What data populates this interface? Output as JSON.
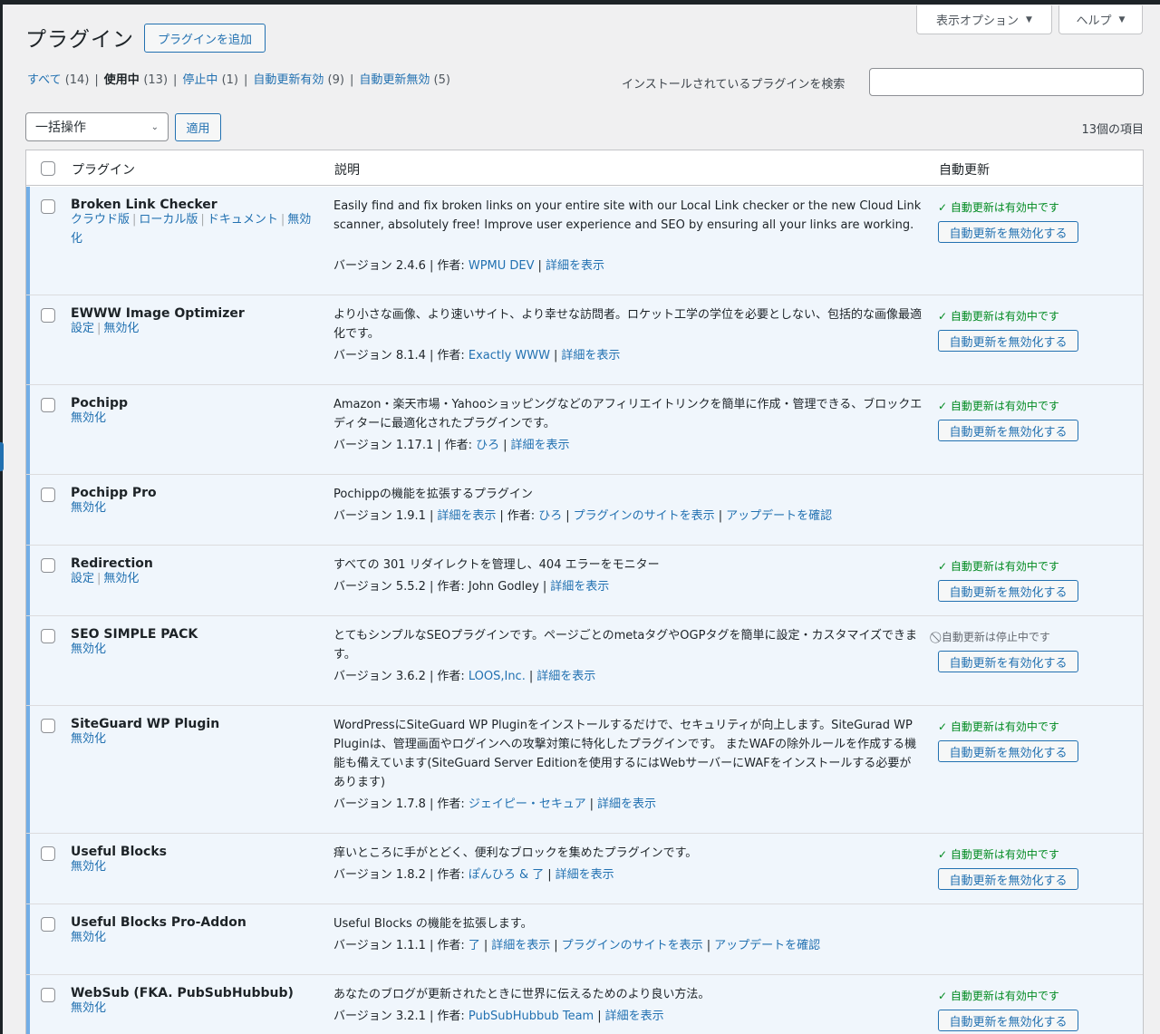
{
  "screen_options": {
    "label": "表示オプション"
  },
  "help": {
    "label": "ヘルプ"
  },
  "page": {
    "title": "プラグイン",
    "add_button": "プラグインを追加"
  },
  "filters": [
    {
      "label": "すべて",
      "count": "(14)"
    },
    {
      "label": "使用中",
      "count": "(13)"
    },
    {
      "label": "停止中",
      "count": "(1)"
    },
    {
      "label": "自動更新有効",
      "count": "(9)"
    },
    {
      "label": "自動更新無効",
      "count": "(5)"
    }
  ],
  "search": {
    "label": "インストールされているプラグインを検索",
    "value": ""
  },
  "bulk": {
    "selected": "一括操作",
    "apply": "適用",
    "item_count": "13個の項目"
  },
  "columns": {
    "plugin": "プラグイン",
    "description": "説明",
    "auto_update": "自動更新"
  },
  "plugins": [
    {
      "name": "Broken Link Checker",
      "actions": [
        "クラウド版",
        "ローカル版",
        "ドキュメント",
        "無効化"
      ],
      "description": "Easily find and fix broken links on your entire site with our Local Link checker or the new Cloud Link scanner, absolutely free! Improve user experience and SEO by ensuring all your links are working.",
      "meta": [
        {
          "text": "バージョン 2.4.6"
        },
        {
          "text": "作者: ",
          "link": "WPMU DEV"
        },
        {
          "link": "詳細を表示"
        }
      ],
      "au_status": "✓ 自動更新は有効中です",
      "au_button": "自動更新を無効化する"
    },
    {
      "name": "EWWW Image Optimizer",
      "actions": [
        "設定",
        "無効化"
      ],
      "description": "より小さな画像、より速いサイト、より幸せな訪問者。ロケット工学の学位を必要としない、包括的な画像最適化です。",
      "meta": [
        {
          "text": "バージョン 8.1.4"
        },
        {
          "text": "作者: ",
          "link": "Exactly WWW"
        },
        {
          "link": "詳細を表示"
        }
      ],
      "au_status": "✓ 自動更新は有効中です",
      "au_button": "自動更新を無効化する"
    },
    {
      "name": "Pochipp",
      "actions": [
        "無効化"
      ],
      "description": "Amazon・楽天市場・Yahooショッピングなどのアフィリエイトリンクを簡単に作成・管理できる、ブロックエディターに最適化されたプラグインです。",
      "meta": [
        {
          "text": "バージョン 1.17.1"
        },
        {
          "text": "作者: ",
          "link": "ひろ"
        },
        {
          "link": "詳細を表示"
        }
      ],
      "au_status": "✓ 自動更新は有効中です",
      "au_button": "自動更新を無効化する"
    },
    {
      "name": "Pochipp Pro",
      "actions": [
        "無効化"
      ],
      "description": "Pochippの機能を拡張するプラグイン",
      "meta": [
        {
          "text": "バージョン 1.9.1"
        },
        {
          "link": "詳細を表示"
        },
        {
          "text": "作者: ",
          "link": "ひろ"
        },
        {
          "link": "プラグインのサイトを表示"
        },
        {
          "link": "アップデートを確認"
        }
      ],
      "au_status": "",
      "au_button": ""
    },
    {
      "name": "Redirection",
      "actions": [
        "設定",
        "無効化"
      ],
      "description": "すべての 301 リダイレクトを管理し、404 エラーをモニター",
      "meta": [
        {
          "text": "バージョン 5.5.2"
        },
        {
          "text": "作者: John Godley"
        },
        {
          "link": "詳細を表示"
        }
      ],
      "au_status": "✓ 自動更新は有効中です",
      "au_button": "自動更新を無効化する"
    },
    {
      "name": "SEO SIMPLE PACK",
      "actions": [
        "無効化"
      ],
      "description": "とてもシンプルなSEOプラグインです。ページごとのmetaタグやOGPタグを簡単に設定・カスタマイズできます。",
      "meta": [
        {
          "text": "バージョン 3.6.2"
        },
        {
          "text": "作者: ",
          "link": "LOOS,Inc."
        },
        {
          "link": "詳細を表示"
        }
      ],
      "au_status": "⃠ 自動更新は停止中です",
      "au_button": "自動更新を有効化する"
    },
    {
      "name": "SiteGuard WP Plugin",
      "actions": [
        "無効化"
      ],
      "description": "WordPressにSiteGuard WP Pluginをインストールするだけで、セキュリティが向上します。SiteGurad WP Pluginは、管理画面やログインへの攻撃対策に特化したプラグインです。 またWAFの除外ルールを作成する機能も備えています(SiteGuard Server Editionを使用するにはWebサーバーにWAFをインストールする必要があります)",
      "meta": [
        {
          "text": "バージョン 1.7.8"
        },
        {
          "text": "作者: ",
          "link": "ジェイピー・セキュア"
        },
        {
          "link": "詳細を表示"
        }
      ],
      "au_status": "✓ 自動更新は有効中です",
      "au_button": "自動更新を無効化する"
    },
    {
      "name": "Useful Blocks",
      "actions": [
        "無効化"
      ],
      "description": "痒いところに手がとどく、便利なブロックを集めたプラグインです。",
      "meta": [
        {
          "text": "バージョン 1.8.2"
        },
        {
          "text": "作者: ",
          "link": "ぽんひろ & 了"
        },
        {
          "link": "詳細を表示"
        }
      ],
      "au_status": "✓ 自動更新は有効中です",
      "au_button": "自動更新を無効化する"
    },
    {
      "name": "Useful Blocks Pro-Addon",
      "actions": [
        "無効化"
      ],
      "description": "Useful Blocks の機能を拡張します。",
      "meta": [
        {
          "text": "バージョン 1.1.1"
        },
        {
          "text": "作者: ",
          "link": "了"
        },
        {
          "link": "詳細を表示"
        },
        {
          "link": "プラグインのサイトを表示"
        },
        {
          "link": "アップデートを確認"
        }
      ],
      "au_status": "",
      "au_button": ""
    },
    {
      "name": "WebSub (FKA. PubSubHubbub)",
      "actions": [
        "無効化"
      ],
      "description": "あなたのブログが更新されたときに世界に伝えるためのより良い方法。",
      "meta": [
        {
          "text": "バージョン 3.2.1"
        },
        {
          "text": "作者: ",
          "link": "PubSubHubbub Team"
        },
        {
          "link": "詳細を表示"
        }
      ],
      "au_status": "✓ 自動更新は有効中です",
      "au_button": "自動更新を無効化する"
    }
  ]
}
